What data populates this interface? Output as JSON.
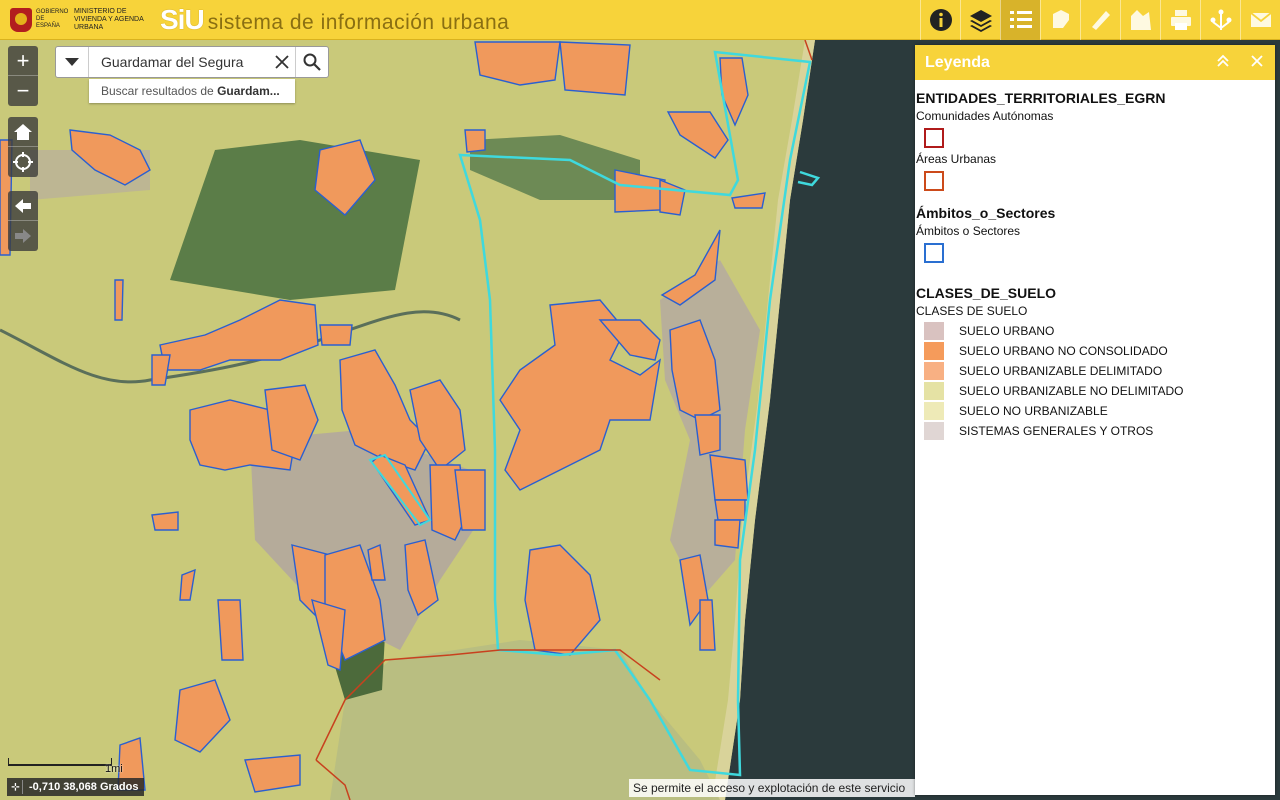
{
  "header": {
    "gov_label": "Gobierno de España",
    "ministry_label": "Ministerio de Vivienda y Agenda Urbana",
    "logo_text": "SiU",
    "title": "sistema de información urbana"
  },
  "toolbar": {
    "tools": [
      "info-icon",
      "layers-icon",
      "legend-icon",
      "edit-icon",
      "measure-icon",
      "bookmark-icon",
      "print-icon",
      "share-icon",
      "mail-icon"
    ],
    "active": "legend-icon"
  },
  "search": {
    "value": "Guardamar del Segura",
    "suggestion_prefix": "Buscar resultados de ",
    "suggestion_bold": "Guardam..."
  },
  "map_controls": {
    "zoom_in": "+",
    "zoom_out": "−"
  },
  "scale": {
    "label": "1mi"
  },
  "coordinates": {
    "text": "-0,710 38,068 Grados"
  },
  "attribution": {
    "text": "Se permite el acceso y explotación de este servicio"
  },
  "legend": {
    "title": "Leyenda",
    "sections": [
      {
        "layer": "ENTIDADES_TERRITORIALES_EGRN",
        "items": [
          {
            "label": "Comunidades Autónomas",
            "color": "#b01b1b"
          },
          {
            "label": "Áreas Urbanas",
            "color": "#cc4a1a"
          }
        ]
      },
      {
        "layer": "Ámbitos_o_Sectores",
        "items": [
          {
            "label": "Ámbitos o Sectores",
            "color": "#2a6fd1"
          }
        ]
      },
      {
        "layer": "CLASES_DE_SUELO",
        "sub": "CLASES DE SUELO",
        "classes": [
          {
            "label": "SUELO URBANO",
            "color": "#d9c2c0"
          },
          {
            "label": "SUELO URBANO NO CONSOLIDADO",
            "color": "#f59b5b"
          },
          {
            "label": "SUELO URBANIZABLE DELIMITADO",
            "color": "#f8b083"
          },
          {
            "label": "SUELO URBANIZABLE NO DELIMITADO",
            "color": "#e5e2a4"
          },
          {
            "label": "SUELO NO URBANIZABLE",
            "color": "#eeeab7"
          },
          {
            "label": "SISTEMAS GENERALES Y OTROS",
            "color": "#e0d6d4"
          }
        ]
      }
    ]
  },
  "colors": {
    "header": "#f7d33a",
    "land": "#c9c97a",
    "sea": "#2a3a3e",
    "urban": "#f59b5b",
    "boundary_cyan": "#3fd9dd",
    "sector_blue": "#2a5fd1"
  }
}
